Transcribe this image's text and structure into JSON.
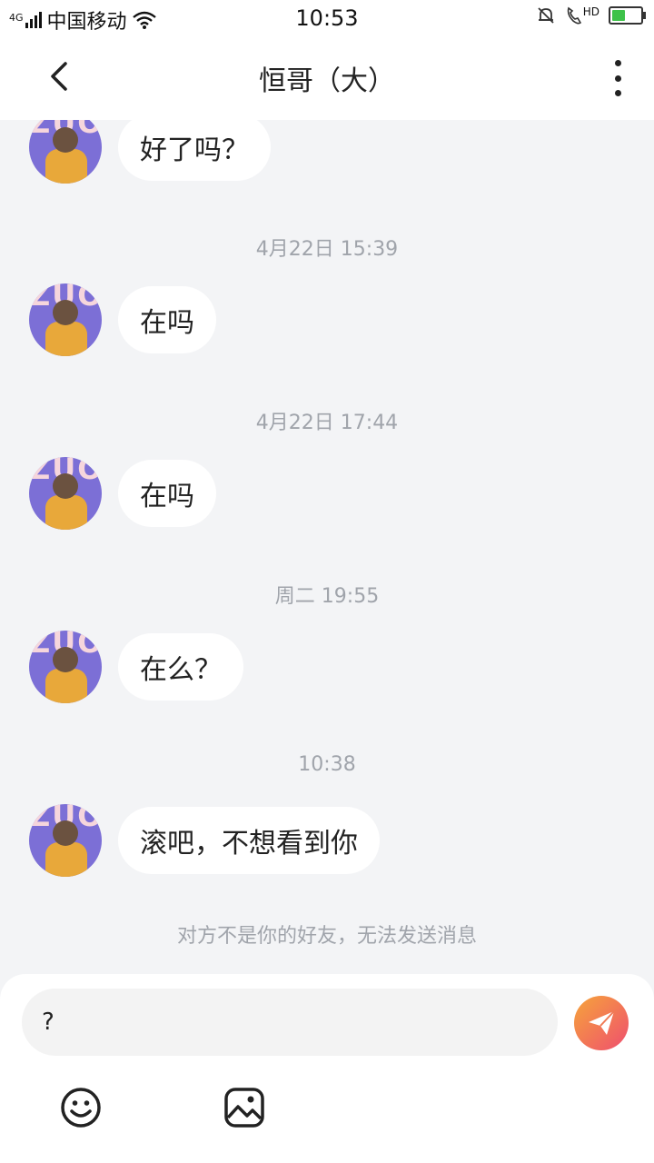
{
  "status_bar": {
    "network": "4G",
    "carrier": "中国移动",
    "time": "10:53",
    "hd_label": "HD"
  },
  "header": {
    "title": "恒哥（大）"
  },
  "avatar_text": "ZUO",
  "messages": [
    {
      "text": "好了吗？"
    },
    {
      "timestamp": "4月22日 15:39",
      "text": "在吗"
    },
    {
      "timestamp": "4月22日 17:44",
      "text": "在吗"
    },
    {
      "timestamp": "周二 19:55",
      "text": "在么？"
    },
    {
      "timestamp": "10:38",
      "text": "滚吧，不想看到你"
    }
  ],
  "notice": "对方不是你的好友，无法发送消息",
  "composer": {
    "input_value": "?"
  },
  "colors": {
    "background": "#f3f4f6",
    "bubble": "#ffffff",
    "timestamp": "#a0a4ab",
    "avatar": "#7c6fd6",
    "send_gradient_start": "#f6a53a",
    "send_gradient_end": "#ef4e6f",
    "battery": "#3ec24a"
  }
}
